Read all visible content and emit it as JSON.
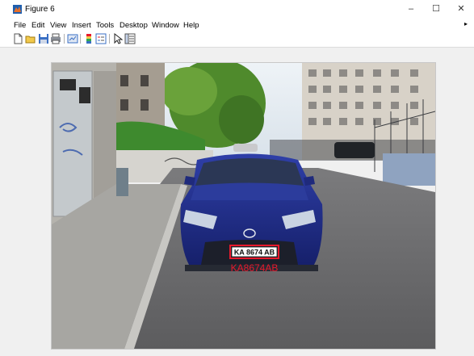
{
  "window": {
    "title": "Figure 6",
    "controls": {
      "minimize": "–",
      "maximize": "☐",
      "close": "✕"
    }
  },
  "menu": [
    "File",
    "Edit",
    "View",
    "Insert",
    "Tools",
    "Desktop",
    "Window",
    "Help"
  ],
  "toolbar": {
    "icons": [
      "new-figure-icon",
      "open-file-icon",
      "save-icon",
      "print-icon",
      "link-plot-icon",
      "insert-colorbar-icon",
      "insert-legend-icon",
      "edit-plot-icon",
      "property-inspector-icon"
    ]
  },
  "image": {
    "plate_text": "KA 8674 AB",
    "recognized_text": "KA8674AB",
    "annotation_color": "#e8192c"
  }
}
